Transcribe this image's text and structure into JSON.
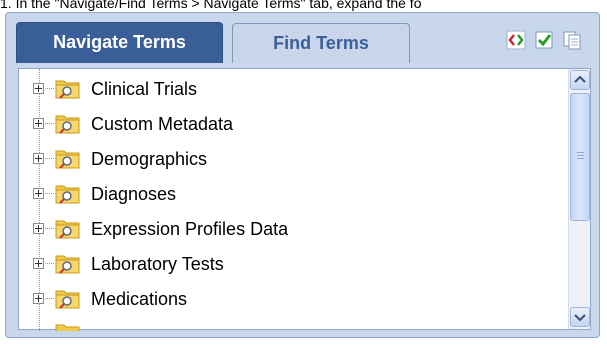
{
  "instruction": "1. In the \"Navigate/Find Terms > Navigate Terms\" tab, expand the fo",
  "tabs": [
    {
      "label": "Navigate Terms",
      "active": true
    },
    {
      "label": "Find Terms",
      "active": false
    }
  ],
  "toolbar": {
    "icons": [
      "expand-collapse-icon",
      "check-icon",
      "copy-icon"
    ]
  },
  "tree": {
    "items": [
      {
        "label": "Clinical Trials"
      },
      {
        "label": "Custom Metadata"
      },
      {
        "label": "Demographics"
      },
      {
        "label": "Diagnoses"
      },
      {
        "label": "Expression Profiles Data"
      },
      {
        "label": "Laboratory Tests"
      },
      {
        "label": "Medications"
      }
    ]
  },
  "colors": {
    "active_tab": "#3a5f98",
    "panel_bg": "#c8d7ec",
    "folder": "#f2c94a"
  }
}
